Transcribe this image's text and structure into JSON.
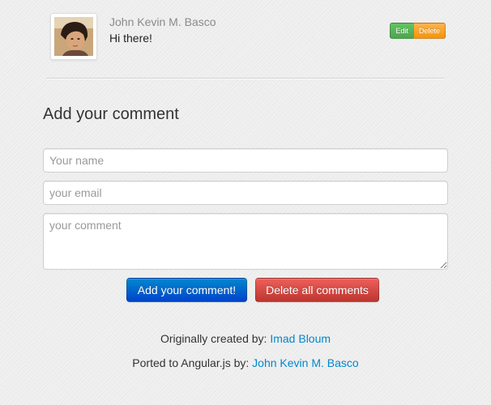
{
  "comment": {
    "author": "John Kevin M. Basco",
    "text": "Hi there!",
    "edit_label": "Edit",
    "delete_label": "Delete"
  },
  "form": {
    "title": "Add your comment",
    "name_placeholder": "Your name",
    "email_placeholder": "your email",
    "comment_placeholder": "your comment",
    "submit_label": "Add your comment!",
    "delete_all_label": "Delete all comments"
  },
  "footer": {
    "line1_prefix": "Originally created by:",
    "line1_link": "Imad Bloum",
    "line2_prefix": "Ported to Angular.js by:",
    "line2_link": "John Kevin M. Basco"
  },
  "colors": {
    "primary": "#0044cc",
    "danger": "#bd362f",
    "success": "#51a351",
    "warning": "#f89406",
    "link": "#0088cc"
  },
  "icons": {
    "avatar": "user-photo"
  }
}
